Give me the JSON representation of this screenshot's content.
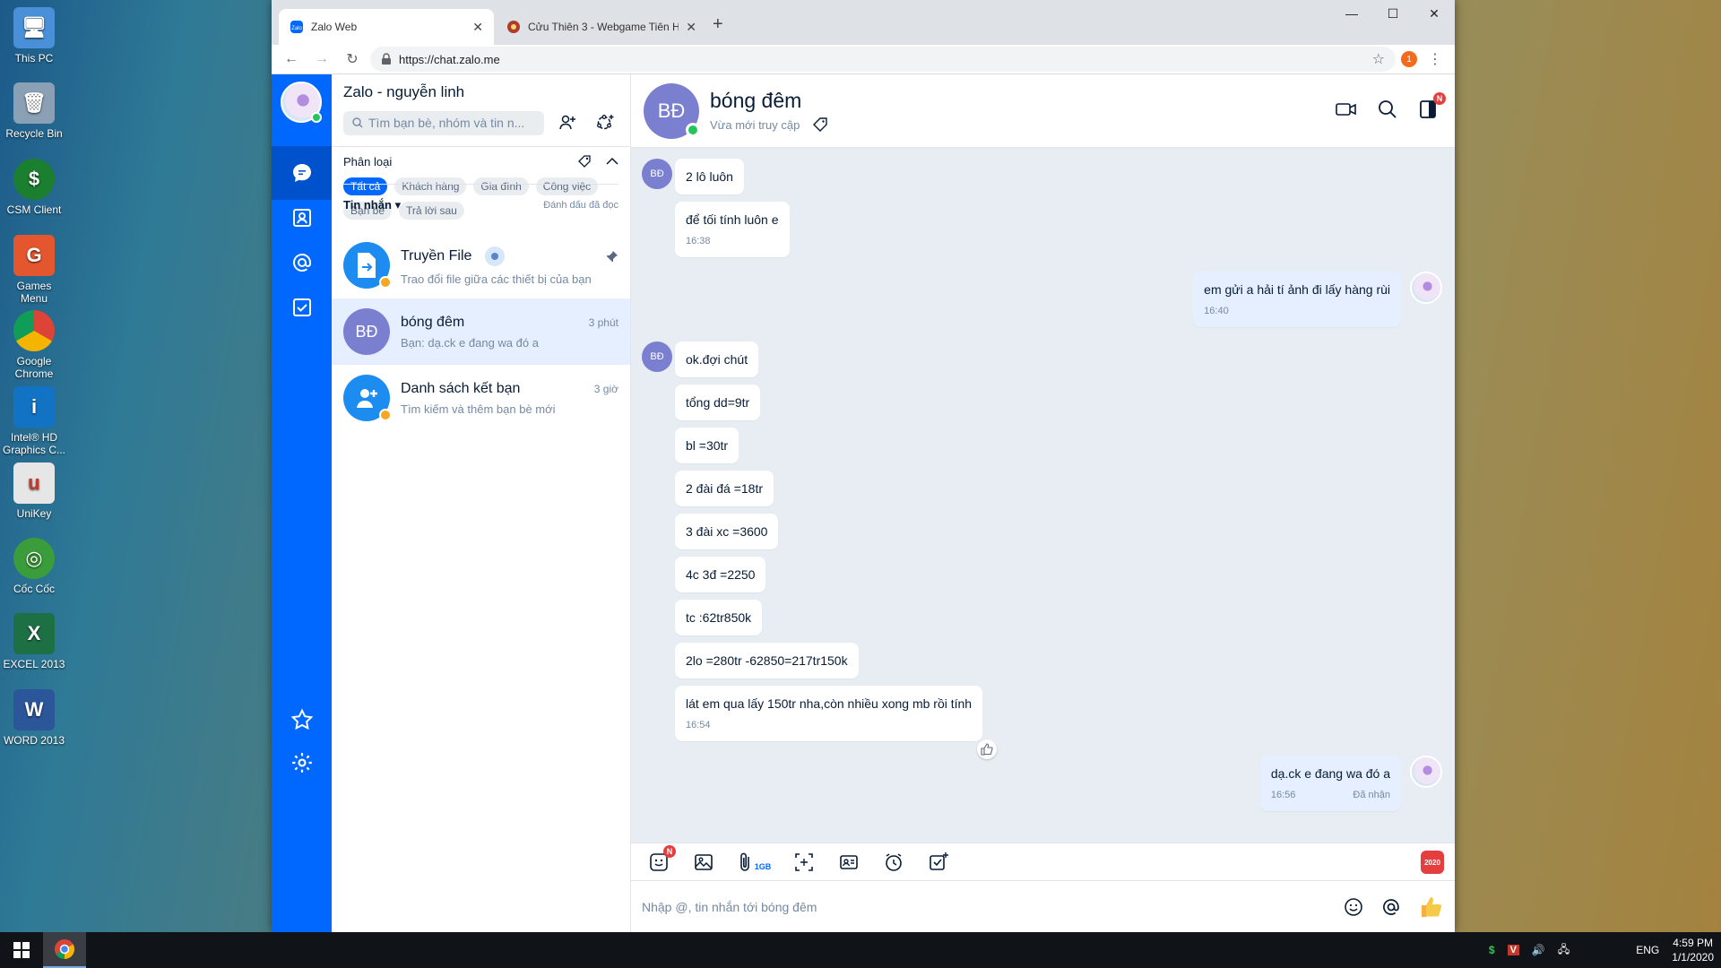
{
  "desktop": {
    "icons": [
      {
        "label": "This PC",
        "color": "#4a90d9"
      },
      {
        "label": "Recycle Bin",
        "color": "#7a8ea3"
      },
      {
        "label": "CSM Client",
        "color": "#1a7f2e"
      },
      {
        "label": "Games Menu",
        "color": "#e4572e"
      },
      {
        "label": "Google Chrome",
        "color": "#ffffff"
      },
      {
        "label": "Intel® HD Graphics C...",
        "color": "#1273c4"
      },
      {
        "label": "UniKey",
        "color": "#d0d0d0"
      },
      {
        "label": "Cốc Cốc",
        "color": "#3a9c3a"
      },
      {
        "label": "EXCEL 2013",
        "color": "#1d7043"
      },
      {
        "label": "WORD 2013",
        "color": "#2b579a"
      }
    ],
    "glyphs": [
      "🖥",
      "🗑",
      "$",
      "G",
      "◉",
      "i",
      "u",
      "◎",
      "X",
      "W"
    ]
  },
  "taskbar": {
    "lang": "ENG",
    "time": "4:59 PM",
    "date": "1/1/2020"
  },
  "browser": {
    "tabs": [
      {
        "title": "Zalo Web"
      },
      {
        "title": "Cửu Thiên 3 - Webgame Tiên Hi..."
      }
    ],
    "url": "https://chat.zalo.me",
    "ext_badge": "1"
  },
  "zalo": {
    "account_title": "Zalo - nguyễn linh",
    "search_placeholder": "Tìm bạn bè, nhóm và tin n...",
    "filter_label": "Phân loại",
    "chips": [
      "Tất cả",
      "Khách hàng",
      "Gia đình",
      "Công việc",
      "Bạn bè",
      "Trả lời sau"
    ],
    "messages_label": "Tin nhắn",
    "mark_read": "Đánh dấu đã đọc",
    "conversations": [
      {
        "name": "Truyền File",
        "preview": "Trao đổi file giữa các thiết bị của bạn",
        "time": "",
        "initials": ""
      },
      {
        "name": "bóng đêm",
        "preview": "Bạn: dạ.ck e đang wa đó a",
        "time": "3 phút",
        "initials": "BĐ"
      },
      {
        "name": "Danh sách kết bạn",
        "preview": "Tìm kiếm và thêm bạn bè mới",
        "time": "3 giờ",
        "initials": ""
      }
    ],
    "chat": {
      "name": "bóng đêm",
      "initials": "BĐ",
      "status": "Vừa mới truy cập",
      "messages": [
        {
          "text": "2 lô luôn",
          "time": ""
        },
        {
          "text": "để tối tính luôn e",
          "time": "16:38"
        },
        {
          "text": "em gửi a hải tí ảnh đi lấy hàng rùi",
          "time": "16:40"
        },
        {
          "text": "ok.đợi chút",
          "time": ""
        },
        {
          "text": "tổng dd=9tr",
          "time": ""
        },
        {
          "text": "bl =30tr",
          "time": ""
        },
        {
          "text": "2 đài đá =18tr",
          "time": ""
        },
        {
          "text": "3 đài xc =3600",
          "time": ""
        },
        {
          "text": "4c 3đ =2250",
          "time": ""
        },
        {
          "text": "tc :62tr850k",
          "time": ""
        },
        {
          "text": "2lo =280tr -62850=217tr150k",
          "time": ""
        },
        {
          "text": "lát em qua lấy 150tr nha,còn nhiều xong mb rồi tính",
          "time": "16:54"
        },
        {
          "text": "dạ.ck e đang wa đó a",
          "time": "16:56",
          "receipt": "Đã nhận"
        }
      ],
      "composer_placeholder": "Nhập @, tin nhắn tới bóng đêm",
      "upload_limit": "1GB",
      "sticker_badge": "N",
      "todo_badge": "N",
      "year_badge": "2020"
    }
  }
}
